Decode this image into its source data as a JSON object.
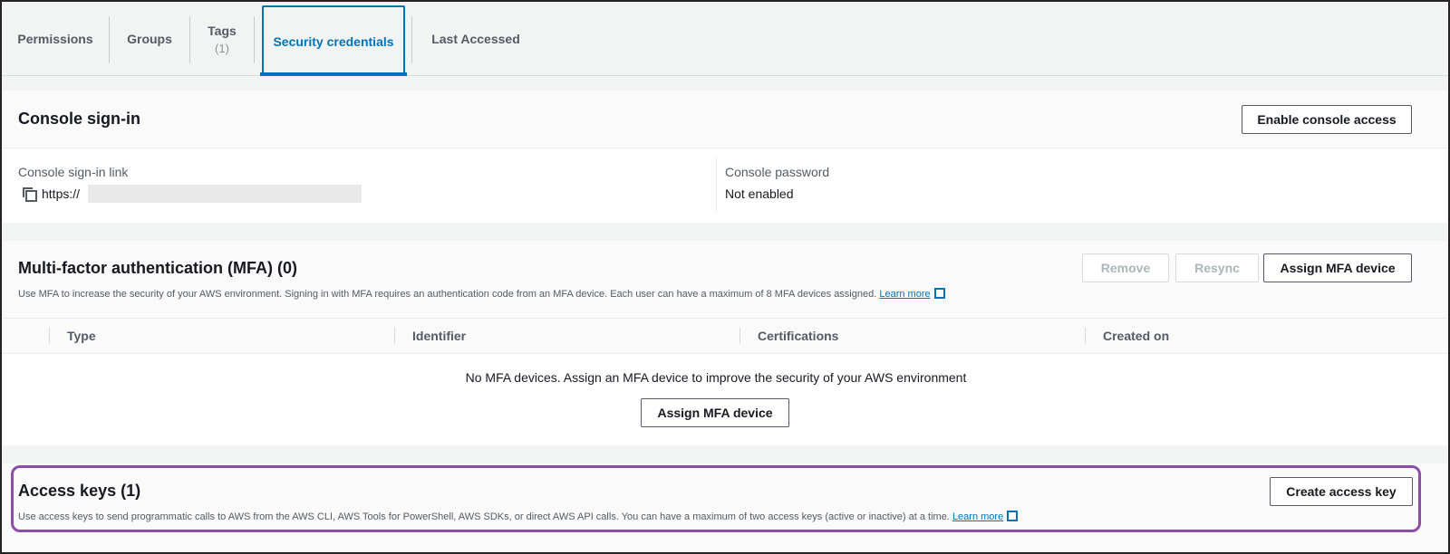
{
  "tabs": [
    {
      "label": "Permissions",
      "count": ""
    },
    {
      "label": "Groups",
      "count": ""
    },
    {
      "label": "Tags",
      "count": "(1)"
    },
    {
      "label": "Security credentials",
      "count": ""
    },
    {
      "label": "Last Accessed",
      "count": ""
    }
  ],
  "active_tab": "Security credentials",
  "console_signin": {
    "title": "Console sign-in",
    "enable_button": "Enable console access",
    "link_label": "Console sign-in link",
    "link_value": "https://",
    "password_label": "Console password",
    "password_value": "Not enabled"
  },
  "mfa": {
    "title": "Multi-factor authentication (MFA) (0)",
    "description": "Use MFA to increase the security of your AWS environment. Signing in with MFA requires an authentication code from an MFA device. Each user can have a maximum of 8 MFA devices assigned.",
    "learn_more": "Learn more",
    "remove_button": "Remove",
    "resync_button": "Resync",
    "assign_button": "Assign MFA device",
    "columns": [
      "Type",
      "Identifier",
      "Certifications",
      "Created on"
    ],
    "empty_message": "No MFA devices. Assign an MFA device to improve the security of your AWS environment",
    "empty_assign_button": "Assign MFA device"
  },
  "access_keys": {
    "title": "Access keys (1)",
    "description": "Use access keys to send programmatic calls to AWS from the AWS CLI, AWS Tools for PowerShell, AWS SDKs, or direct AWS API calls. You can have a maximum of two access keys (active or inactive) at a time.",
    "learn_more": "Learn more",
    "create_button": "Create access key"
  },
  "colors": {
    "accent": "#0073bb",
    "highlight": "#8c4fa8"
  }
}
